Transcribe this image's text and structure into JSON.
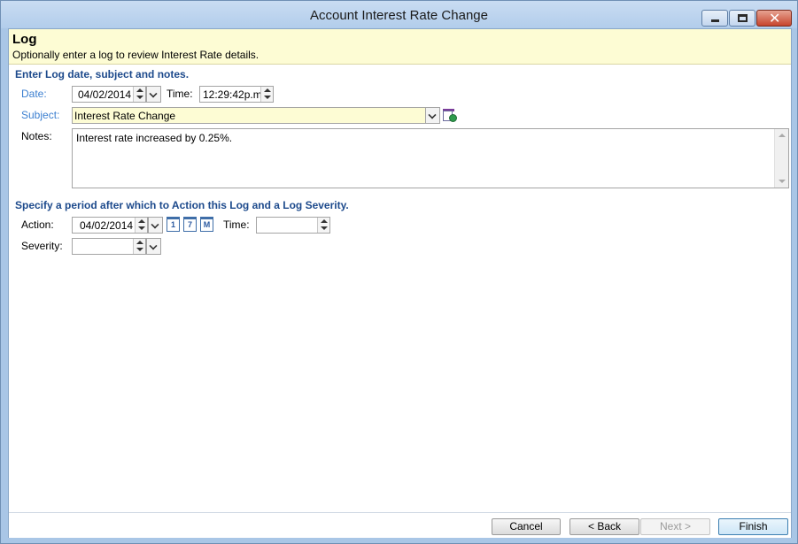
{
  "window": {
    "title": "Account Interest Rate Change"
  },
  "header": {
    "title": "Log",
    "subtitle": "Optionally enter a log to review Interest Rate details."
  },
  "log_section": {
    "heading": "Enter Log date, subject and notes.",
    "date_label": "Date:",
    "date_value": "04/02/2014",
    "time_label": "Time:",
    "time_value": "12:29:42p.m",
    "subject_label": "Subject:",
    "subject_value": "Interest Rate Change",
    "notes_label": "Notes:",
    "notes_value": "Interest rate increased by 0.25%."
  },
  "action_section": {
    "heading": "Specify a period after which to Action this Log and a Log Severity.",
    "action_label": "Action:",
    "action_value": "04/02/2014",
    "quick_buttons": [
      "1",
      "7",
      "M"
    ],
    "time_label": "Time:",
    "time_value": "",
    "severity_label": "Severity:",
    "severity_value": ""
  },
  "footer": {
    "cancel": "Cancel",
    "back": "< Back",
    "next": "Next >",
    "finish": "Finish"
  },
  "icons": {
    "minimize": "minimize-icon",
    "maximize": "maximize-icon",
    "close": "close-icon",
    "subject_lookup": "subject-lookup-icon",
    "calendar": "calendar-icon"
  }
}
